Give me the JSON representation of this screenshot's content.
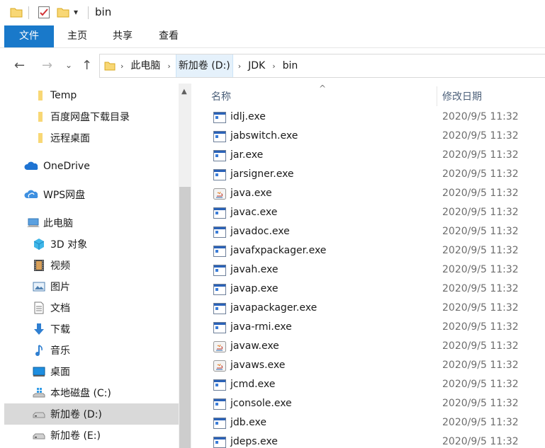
{
  "window": {
    "title": "bin",
    "quick_access_dropdown": "▾"
  },
  "ribbon": {
    "tabs": [
      {
        "label": "文件",
        "active": true
      },
      {
        "label": "主页"
      },
      {
        "label": "共享"
      },
      {
        "label": "查看"
      }
    ]
  },
  "navigation": {
    "back": "←",
    "forward": "→",
    "recent": "⌄",
    "up": "↑"
  },
  "address_bar": {
    "breadcrumbs": [
      "此电脑",
      "新加卷 (D:)",
      "JDK",
      "bin"
    ],
    "separator": "›"
  },
  "nav_pane": {
    "items": [
      {
        "label": "Temp",
        "icon": "folder-icon"
      },
      {
        "label": "百度网盘下载目录",
        "icon": "folder-icon"
      },
      {
        "label": "远程桌面",
        "icon": "folder-icon"
      },
      {
        "label": "OneDrive",
        "icon": "onedrive-cloud-icon"
      },
      {
        "label": "WPS网盘",
        "icon": "wps-cloud-icon"
      },
      {
        "label": "此电脑",
        "icon": "this-pc-icon"
      },
      {
        "label": "3D 对象",
        "icon": "3d-objects-icon"
      },
      {
        "label": "视频",
        "icon": "video-icon"
      },
      {
        "label": "图片",
        "icon": "pictures-icon"
      },
      {
        "label": "文档",
        "icon": "documents-icon"
      },
      {
        "label": "下载",
        "icon": "downloads-icon"
      },
      {
        "label": "音乐",
        "icon": "music-icon"
      },
      {
        "label": "桌面",
        "icon": "desktop-icon"
      },
      {
        "label": "本地磁盘 (C:)",
        "icon": "windows-drive-icon"
      },
      {
        "label": "新加卷 (D:)",
        "icon": "drive-icon",
        "selected": true
      },
      {
        "label": "新加卷 (E:)",
        "icon": "drive-icon"
      }
    ]
  },
  "file_list": {
    "columns": {
      "name": "名称",
      "date": "修改日期"
    },
    "sort_indicator": "^",
    "files": [
      {
        "name": "idlj.exe",
        "date": "2020/9/5 11:32",
        "icon": "exe-icon"
      },
      {
        "name": "jabswitch.exe",
        "date": "2020/9/5 11:32",
        "icon": "exe-icon"
      },
      {
        "name": "jar.exe",
        "date": "2020/9/5 11:32",
        "icon": "exe-icon"
      },
      {
        "name": "jarsigner.exe",
        "date": "2020/9/5 11:32",
        "icon": "exe-icon"
      },
      {
        "name": "java.exe",
        "date": "2020/9/5 11:32",
        "icon": "java-icon"
      },
      {
        "name": "javac.exe",
        "date": "2020/9/5 11:32",
        "icon": "exe-icon"
      },
      {
        "name": "javadoc.exe",
        "date": "2020/9/5 11:32",
        "icon": "exe-icon"
      },
      {
        "name": "javafxpackager.exe",
        "date": "2020/9/5 11:32",
        "icon": "exe-icon"
      },
      {
        "name": "javah.exe",
        "date": "2020/9/5 11:32",
        "icon": "exe-icon"
      },
      {
        "name": "javap.exe",
        "date": "2020/9/5 11:32",
        "icon": "exe-icon"
      },
      {
        "name": "javapackager.exe",
        "date": "2020/9/5 11:32",
        "icon": "exe-icon"
      },
      {
        "name": "java-rmi.exe",
        "date": "2020/9/5 11:32",
        "icon": "exe-icon"
      },
      {
        "name": "javaw.exe",
        "date": "2020/9/5 11:32",
        "icon": "java-icon"
      },
      {
        "name": "javaws.exe",
        "date": "2020/9/5 11:32",
        "icon": "java-icon"
      },
      {
        "name": "jcmd.exe",
        "date": "2020/9/5 11:32",
        "icon": "exe-icon"
      },
      {
        "name": "jconsole.exe",
        "date": "2020/9/5 11:32",
        "icon": "exe-icon"
      },
      {
        "name": "jdb.exe",
        "date": "2020/9/5 11:32",
        "icon": "exe-icon"
      },
      {
        "name": "jdeps.exe",
        "date": "2020/9/5 11:32",
        "icon": "exe-icon"
      }
    ]
  },
  "colors": {
    "accent": "#1979ca",
    "folder": "#f8d775",
    "selection": "#d9d9d9",
    "header_text": "#4c607a"
  }
}
